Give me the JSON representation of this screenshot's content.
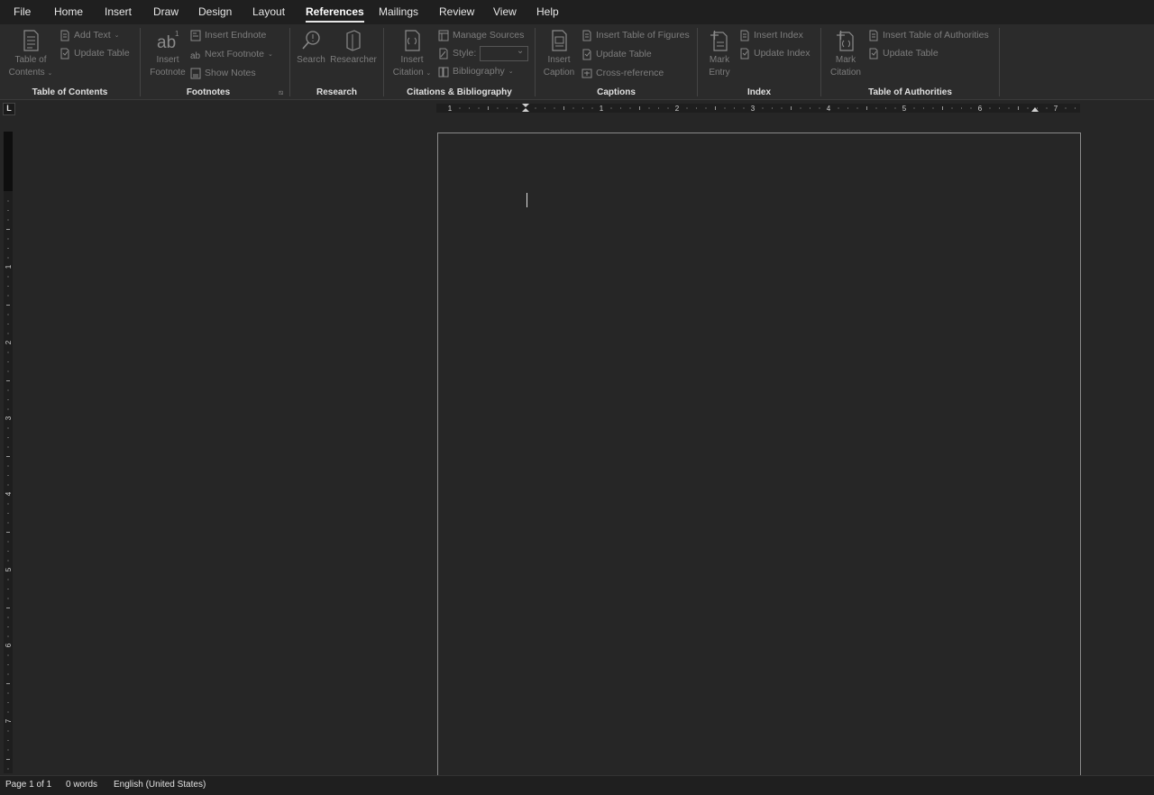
{
  "menu": {
    "tabs": [
      {
        "label": "File"
      },
      {
        "label": "Home"
      },
      {
        "label": "Insert"
      },
      {
        "label": "Draw"
      },
      {
        "label": "Design"
      },
      {
        "label": "Layout"
      },
      {
        "label": "References"
      },
      {
        "label": "Mailings"
      },
      {
        "label": "Review"
      },
      {
        "label": "View"
      },
      {
        "label": "Help"
      }
    ],
    "active": "References"
  },
  "ribbon": {
    "toc": {
      "label": "Table of Contents",
      "toc_line1": "Table of",
      "toc_line2": "Contents",
      "add_text": "Add Text",
      "update_table": "Update Table"
    },
    "footnotes": {
      "label": "Footnotes",
      "insert_line1": "Insert",
      "insert_line2": "Footnote",
      "insert_endnote": "Insert Endnote",
      "next_footnote": "Next Footnote",
      "show_notes": "Show Notes"
    },
    "research": {
      "label": "Research",
      "search": "Search",
      "researcher": "Researcher"
    },
    "citations": {
      "label": "Citations & Bibliography",
      "insert_line1": "Insert",
      "insert_line2": "Citation",
      "manage_sources": "Manage Sources",
      "style": "Style:",
      "bibliography": "Bibliography"
    },
    "captions": {
      "label": "Captions",
      "insert_line1": "Insert",
      "insert_line2": "Caption",
      "insert_tof": "Insert Table of Figures",
      "update_table": "Update Table",
      "cross_reference": "Cross-reference"
    },
    "index": {
      "label": "Index",
      "mark_line1": "Mark",
      "mark_line2": "Entry",
      "insert_index": "Insert Index",
      "update_index": "Update Index"
    },
    "toa": {
      "label": "Table of Authorities",
      "mark_line1": "Mark",
      "mark_line2": "Citation",
      "insert_toa": "Insert Table of Authorities",
      "update_table": "Update Table"
    }
  },
  "ruler": {
    "corner": "L",
    "h_numbers": [
      "1",
      "1",
      "2",
      "3",
      "4",
      "5",
      "6",
      "7"
    ],
    "v_numbers": [
      "1",
      "2",
      "3",
      "4",
      "5",
      "6",
      "7"
    ]
  },
  "status": {
    "page": "Page 1 of 1",
    "words": "0 words",
    "language": "English (United States)"
  },
  "colors": {
    "background": "#262626",
    "ribbon": "#2b2b2b",
    "menubar": "#1f1f1f",
    "disabled_text": "#7d7d7d"
  }
}
